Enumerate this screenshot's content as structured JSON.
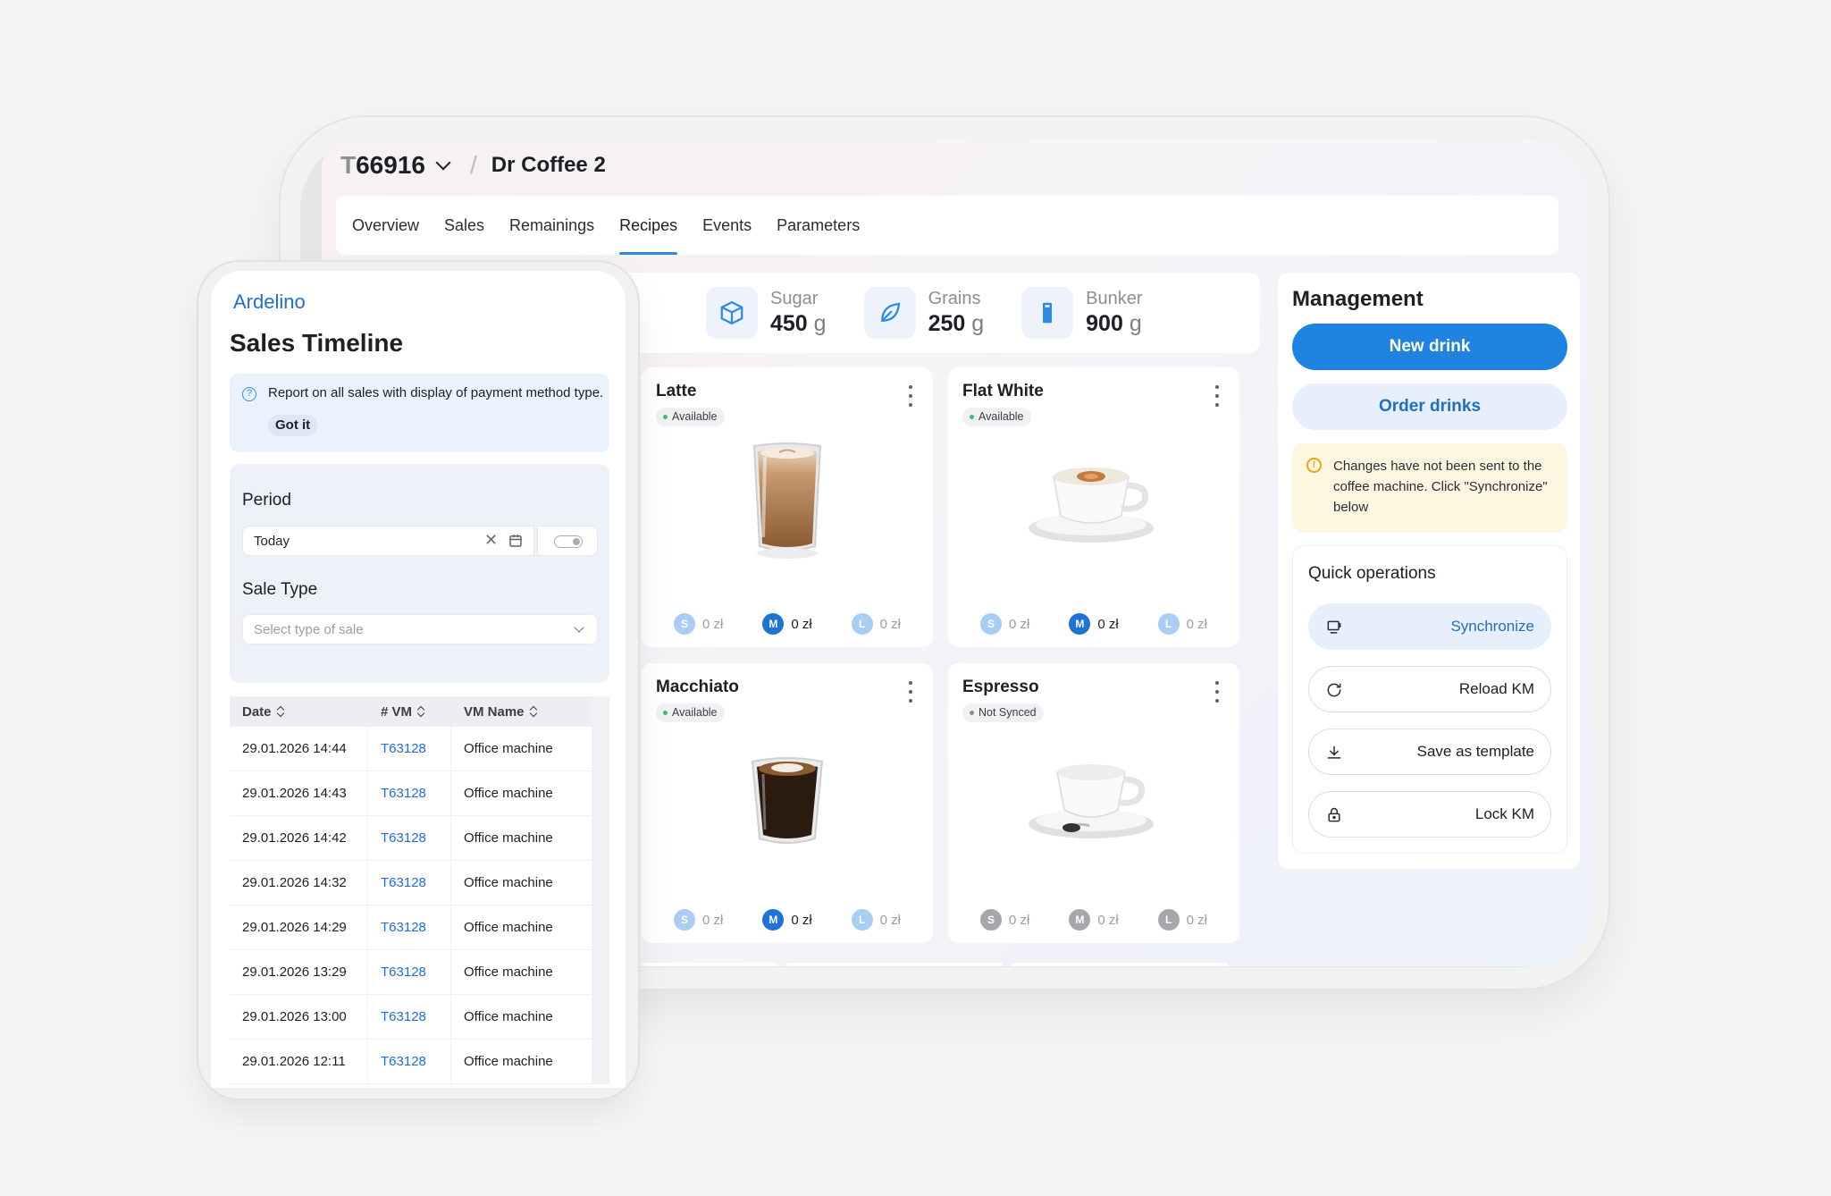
{
  "tablet": {
    "breadcrumb": {
      "machine_id_prefix": "T",
      "machine_id": "66916",
      "separator": "/",
      "machine_name": "Dr Coffee 2"
    },
    "tabs": [
      {
        "label": "Overview",
        "active": false
      },
      {
        "label": "Sales",
        "active": false
      },
      {
        "label": "Remainings",
        "active": false
      },
      {
        "label": "Recipes",
        "active": true
      },
      {
        "label": "Events",
        "active": false
      },
      {
        "label": "Parameters",
        "active": false
      }
    ],
    "resources": [
      {
        "label": "Sugar",
        "value": "450",
        "unit": "g",
        "icon": "cube-icon"
      },
      {
        "label": "Grains",
        "value": "250",
        "unit": "g",
        "icon": "leaf-icon"
      },
      {
        "label": "Bunker",
        "value": "900",
        "unit": "g",
        "icon": "bunker-icon"
      }
    ],
    "drinks": [
      {
        "name": "Latte",
        "status": "Available",
        "sizes": [
          "S",
          "M",
          "L"
        ],
        "prices": [
          "0 zł",
          "0 zł",
          "0 zł"
        ]
      },
      {
        "name": "Flat White",
        "status": "Available",
        "sizes": [
          "S",
          "M",
          "L"
        ],
        "prices": [
          "0 zł",
          "0 zł",
          "0 zł"
        ]
      },
      {
        "name": "Macchiato",
        "status": "Available",
        "sizes": [
          "S",
          "M",
          "L"
        ],
        "prices": [
          "0 zł",
          "0 zł",
          "0 zł"
        ]
      },
      {
        "name": "Espresso",
        "status": "Not Synced",
        "sizes": [
          "S",
          "M",
          "L"
        ],
        "prices": [
          "0 zł",
          "0 zł",
          "0 zł"
        ]
      }
    ],
    "management": {
      "title": "Management",
      "new_drink": "New drink",
      "order_drinks": "Order drinks",
      "warning": "Changes have not been sent to the coffee machine. Click \"Synchronize\" below",
      "quick_title": "Quick operations",
      "quick_ops": [
        "Synchronize",
        "Reload KM",
        "Save as template",
        "Lock KM"
      ]
    },
    "colors": {
      "accent": "#1f83e2",
      "available": "#3fbf6a",
      "warning_bg": "#fdf6e0"
    }
  },
  "phone": {
    "brand": "Ardelino",
    "title": "Sales Timeline",
    "info": {
      "text": "Report on all sales with display of payment method type.",
      "button": "Got it"
    },
    "period_label": "Period",
    "period_value": "Today",
    "sale_type_label": "Sale Type",
    "sale_type_placeholder": "Select type of sale",
    "table": {
      "columns": [
        "Date",
        "# VM",
        "VM Name"
      ],
      "rows": [
        [
          "29.01.2026 14:44",
          "T63128",
          "Office machine"
        ],
        [
          "29.01.2026 14:43",
          "T63128",
          "Office machine"
        ],
        [
          "29.01.2026 14:42",
          "T63128",
          "Office machine"
        ],
        [
          "29.01.2026 14:32",
          "T63128",
          "Office machine"
        ],
        [
          "29.01.2026 14:29",
          "T63128",
          "Office machine"
        ],
        [
          "29.01.2026 13:29",
          "T63128",
          "Office machine"
        ],
        [
          "29.01.2026 13:00",
          "T63128",
          "Office machine"
        ],
        [
          "29.01.2026 12:11",
          "T63128",
          "Office machine"
        ]
      ]
    }
  }
}
